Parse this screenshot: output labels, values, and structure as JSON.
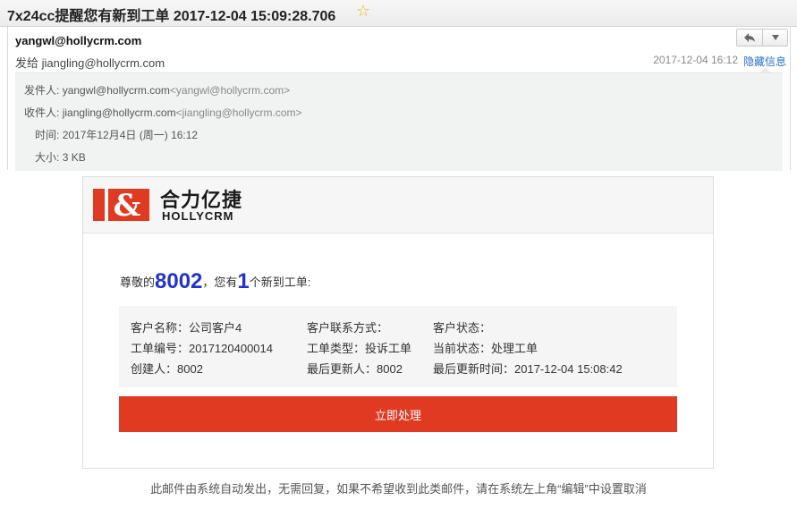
{
  "title_bar": {
    "title": "7x24cc提醒您有新到工单 2017-12-04 15:09:28.706",
    "star_icon": "star-icon"
  },
  "header": {
    "from": "yangwl@hollycrm.com",
    "to_line": "发给 jiangling@hollycrm.com",
    "date": "2017-12-04 16:12",
    "hide_label": "隐藏信息",
    "reply_icon": "reply-icon",
    "more_icon": "chevron-down-icon"
  },
  "details": {
    "sender_label": "发件人:",
    "sender_name": "yangwl@hollycrm.com",
    "sender_addr": "<yangwl@hollycrm.com>",
    "recipient_label": "收件人:",
    "recipient_name": "jiangling@hollycrm.com",
    "recipient_addr": "<jiangling@hollycrm.com>",
    "time_label": "时间:",
    "time_value": "2017年12月4日 (周一) 16:12",
    "size_label": "大小:",
    "size_value": "3 KB"
  },
  "card": {
    "logo_cn": "合力亿捷",
    "logo_en": "HOLLYCRM",
    "logo_brand_color": "#e03a22",
    "greeting_prefix": "尊敬的",
    "user_id": "8002",
    "greeting_mid": "，您有",
    "count": "1",
    "greeting_suffix": "个新到工单:",
    "info": [
      [
        "客户名称：公司客户4",
        "客户联系方式：",
        "客户状态："
      ],
      [
        "工单编号：2017120400014",
        "工单类型：投诉工单",
        "当前状态：处理工单"
      ],
      [
        "创建人：8002",
        "最后更新人：8002",
        "最后更新时间：2017-12-04 15:08:42"
      ]
    ],
    "action_label": "立即处理",
    "action_color": "#e03a22"
  },
  "footer": {
    "note": "此邮件由系统自动发出，无需回复，如果不希望收到此类邮件，请在系统左上角“编辑”中设置取消"
  }
}
